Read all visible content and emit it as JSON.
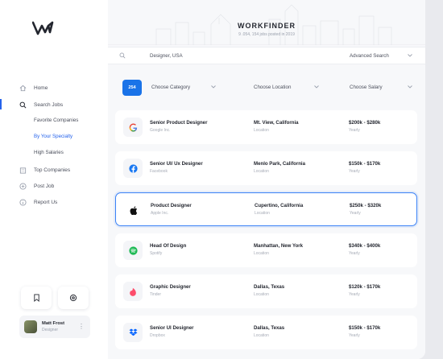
{
  "app": {
    "title": "WORKFINDER",
    "subtitle": "9 .054, 154 jobs posted in 2019"
  },
  "sidebar": {
    "logo_icon": "w-logo-icon",
    "items": [
      {
        "label": "Home",
        "icon": "home-icon"
      },
      {
        "label": "Search Jobs",
        "icon": "search-icon"
      }
    ],
    "sub_items": [
      {
        "label": "Favorite Companies",
        "active": false
      },
      {
        "label": "By Your Specialty",
        "active": true
      },
      {
        "label": "High Salaries",
        "active": false
      }
    ],
    "items_bottom": [
      {
        "label": "Top Companies",
        "icon": "building-icon"
      },
      {
        "label": "Post Job",
        "icon": "plus-circle-icon"
      },
      {
        "label": "Report Us",
        "icon": "info-icon"
      }
    ],
    "bottom_buttons": [
      "bookmark-icon",
      "settings-icon"
    ],
    "profile": {
      "name": "Matt Frost",
      "role": "Designer"
    }
  },
  "search": {
    "value": "Designer, USA",
    "advanced_label": "Advanced Search"
  },
  "filters": {
    "count": "254",
    "category_label": "Choose Category",
    "location_label": "Choose Location",
    "salary_label": "Choose Salary"
  },
  "jobs": [
    {
      "title": "Senior Product Designer",
      "company": "Google Inc.",
      "location": "Mt. View, California",
      "location_label": "Location",
      "salary": "$200k - $280k",
      "salary_label": "Yearly",
      "logo": "google-logo-icon",
      "selected": false
    },
    {
      "title": "Senior UI/ Ux Designer",
      "company": "Facebook",
      "location": "Menlo Park, California",
      "location_label": "Location",
      "salary": "$150k - $170k",
      "salary_label": "Yearly",
      "logo": "facebook-logo-icon",
      "selected": false
    },
    {
      "title": "Product Designer",
      "company": "Apple Inc.",
      "location": "Cupertino, California",
      "location_label": "Location",
      "salary": "$250k - $320k",
      "salary_label": "Yearly",
      "logo": "apple-logo-icon",
      "selected": true
    },
    {
      "title": "Head Of Design",
      "company": "Spotify",
      "location": "Manhattan, New York",
      "location_label": "Location",
      "salary": "$340k - $400k",
      "salary_label": "Yearly",
      "logo": "spotify-logo-icon",
      "selected": false
    },
    {
      "title": "Graphic Designer",
      "company": "Tinder",
      "location": "Dallas, Texas",
      "location_label": "Location",
      "salary": "$120k - $170k",
      "salary_label": "Yearly",
      "logo": "tinder-logo-icon",
      "selected": false
    },
    {
      "title": "Senior UI Designer",
      "company": "Dropbox",
      "location": "Dallas, Texas",
      "location_label": "Location",
      "salary": "$150k - $170k",
      "salary_label": "Yearly",
      "logo": "dropbox-logo-icon",
      "selected": false
    }
  ],
  "colors": {
    "accent": "#1a73e8",
    "selected_border": "#3b82f6",
    "active_text": "#2563eb"
  }
}
